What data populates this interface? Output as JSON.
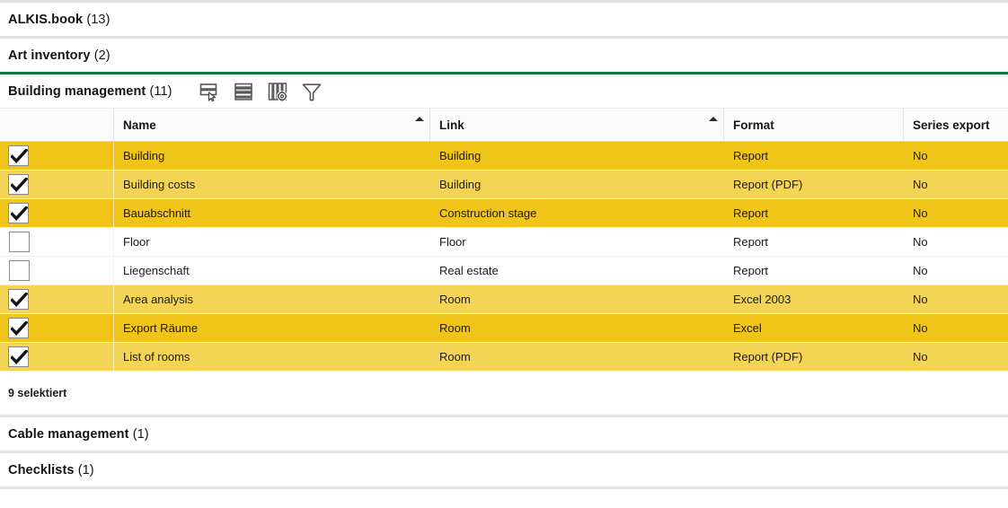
{
  "colors": {
    "selected_row_dark": "#F0C419",
    "selected_row_light": "#F4D454",
    "active_section_underline": "#0B7A3E",
    "divider": "#E2E2E2",
    "header_background": "#FBFBFB"
  },
  "sections": [
    {
      "name": "ALKIS.book",
      "count": "(13)",
      "expanded": false
    },
    {
      "name": "Art inventory",
      "count": "(2)",
      "expanded": false
    },
    {
      "name": "Building management",
      "count": "(11)",
      "expanded": true
    },
    {
      "name": "Cable management",
      "count": "(1)",
      "expanded": false
    },
    {
      "name": "Checklists",
      "count": "(1)",
      "expanded": false
    }
  ],
  "toolbar": {
    "icons": [
      {
        "id": "select-rows-icon",
        "title": "Select rows"
      },
      {
        "id": "list-rows-icon",
        "title": "Show all rows"
      },
      {
        "id": "column-settings-icon",
        "title": "Column settings"
      },
      {
        "id": "filter-icon",
        "title": "Filter"
      }
    ]
  },
  "table": {
    "columns": [
      {
        "key": "checkbox",
        "label": "",
        "sorted": false
      },
      {
        "key": "name",
        "label": "Name",
        "sorted": true,
        "direction": "asc"
      },
      {
        "key": "link",
        "label": "Link",
        "sorted": true,
        "direction": "asc"
      },
      {
        "key": "format",
        "label": "Format",
        "sorted": false
      },
      {
        "key": "series",
        "label": "Series export",
        "sorted": false
      }
    ],
    "rows": [
      {
        "checked": true,
        "shade": "dark",
        "name": "Building",
        "link": "Building",
        "format": "Report",
        "series": "No"
      },
      {
        "checked": true,
        "shade": "light",
        "name": "Building costs",
        "link": "Building",
        "format": "Report (PDF)",
        "series": "No"
      },
      {
        "checked": true,
        "shade": "dark",
        "name": "Bauabschnitt",
        "link": "Construction stage",
        "format": "Report",
        "series": "No"
      },
      {
        "checked": false,
        "shade": "none",
        "name": "Floor",
        "link": "Floor",
        "format": "Report",
        "series": "No"
      },
      {
        "checked": false,
        "shade": "none",
        "name": "Liegenschaft",
        "link": "Real estate",
        "format": "Report",
        "series": "No"
      },
      {
        "checked": true,
        "shade": "light",
        "name": "Area analysis",
        "link": "Room",
        "format": "Excel 2003",
        "series": "No"
      },
      {
        "checked": true,
        "shade": "dark",
        "name": "Export Räume",
        "link": "Room",
        "format": "Excel",
        "series": "No"
      },
      {
        "checked": true,
        "shade": "light",
        "name": "List of rooms",
        "link": "Room",
        "format": "Report (PDF)",
        "series": "No"
      }
    ]
  },
  "status": {
    "text": "9 selektiert"
  }
}
